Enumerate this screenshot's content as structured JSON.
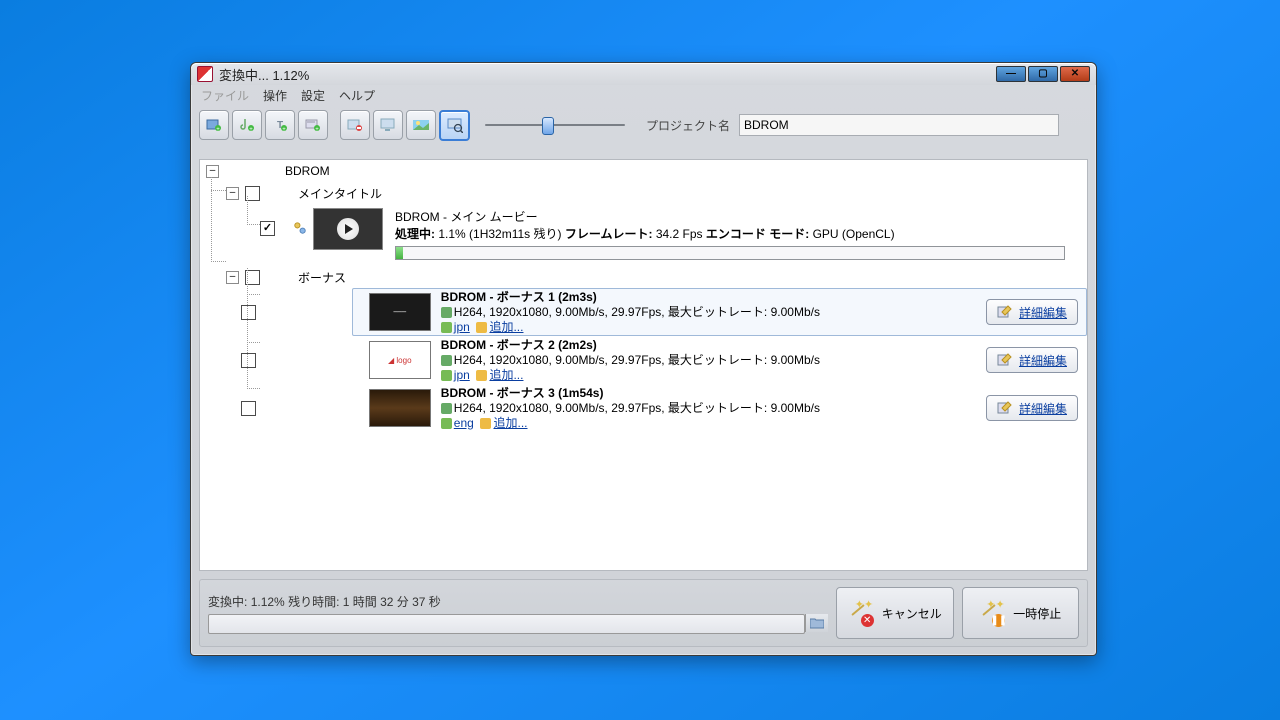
{
  "title": "変換中... 1.12%",
  "menu": {
    "file": "ファイル",
    "action": "操作",
    "settings": "設定",
    "help": "ヘルプ"
  },
  "project_label": "プロジェクト名",
  "project_name": "BDROM",
  "tree": {
    "root": "BDROM",
    "main_title_label": "メインタイトル",
    "main": {
      "name": "BDROM - メイン ムービー",
      "proc_label": "処理中:",
      "proc_value": "1.1% (1H32m11s 残り)",
      "fps_label": "フレームレート:",
      "fps_value": "34.2 Fps",
      "enc_label": "エンコード モード:",
      "enc_value": "GPU (OpenCL)"
    },
    "bonus_label": "ボーナス",
    "bonus": [
      {
        "title": "BDROM - ボーナス 1 (2m3s)",
        "spec": "H264, 1920x1080, 9.00Mb/s, 29.97Fps, 最大ビットレート: 9.00Mb/s",
        "audio": "jpn",
        "sub": "追加..."
      },
      {
        "title": "BDROM - ボーナス 2 (2m2s)",
        "spec": "H264, 1920x1080, 9.00Mb/s, 29.97Fps, 最大ビットレート: 9.00Mb/s",
        "audio": "jpn",
        "sub": "追加..."
      },
      {
        "title": "BDROM - ボーナス 3 (1m54s)",
        "spec": "H264, 1920x1080, 9.00Mb/s, 29.97Fps, 最大ビットレート: 9.00Mb/s",
        "audio": "eng",
        "sub": "追加..."
      }
    ],
    "edit_label": "詳細編集"
  },
  "footer": {
    "status_prefix": "変換中:",
    "percent": "1.12%",
    "remain_label": "残り時間:",
    "remain_value": "1 時間 32 分 37 秒",
    "cancel": "キャンセル",
    "pause": "一時停止"
  }
}
